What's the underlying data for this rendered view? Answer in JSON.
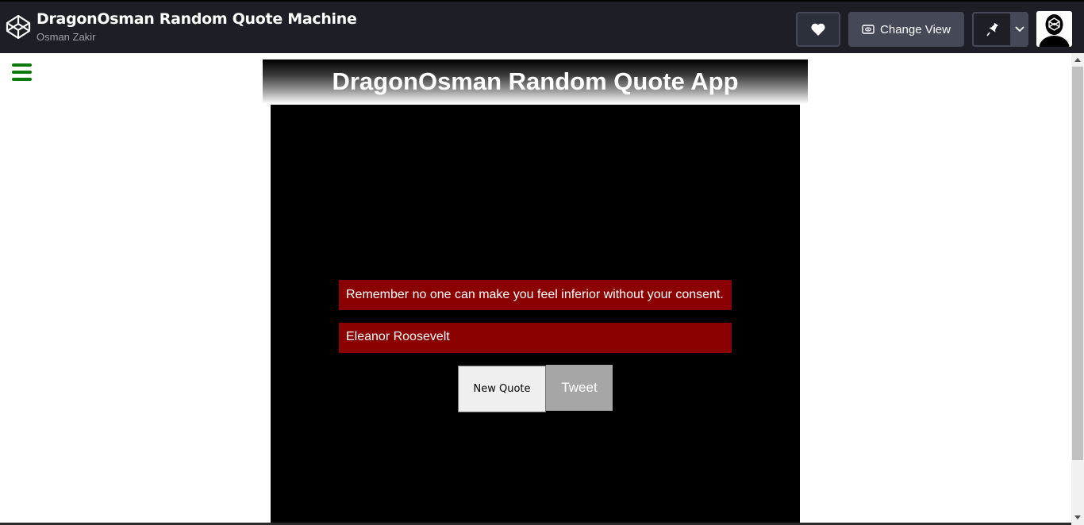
{
  "header": {
    "pen_title": "DragonOsman Random Quote Machine",
    "author": "Osman Zakir",
    "change_view_label": "Change View",
    "logo_icon": "codepen-logo-icon",
    "heart_icon": "heart-icon",
    "view_icon": "eye-icon",
    "pin_icon": "pin-icon",
    "dropdown_icon": "chevron-down-icon"
  },
  "app": {
    "title": "DragonOsman Random Quote App",
    "quote": "Remember no one can make you feel inferior without your consent.",
    "author": "Eleanor Roosevelt",
    "new_quote_label": "New Quote",
    "tweet_label": "Tweet",
    "menu_icon": "hamburger-menu-icon"
  },
  "colors": {
    "topbar": "#1e1f26",
    "menu_icon": "#0b7a0b",
    "quote_bg": "#8b0000",
    "box_bg": "#000000",
    "tweet_bg": "#a6a6a6"
  }
}
